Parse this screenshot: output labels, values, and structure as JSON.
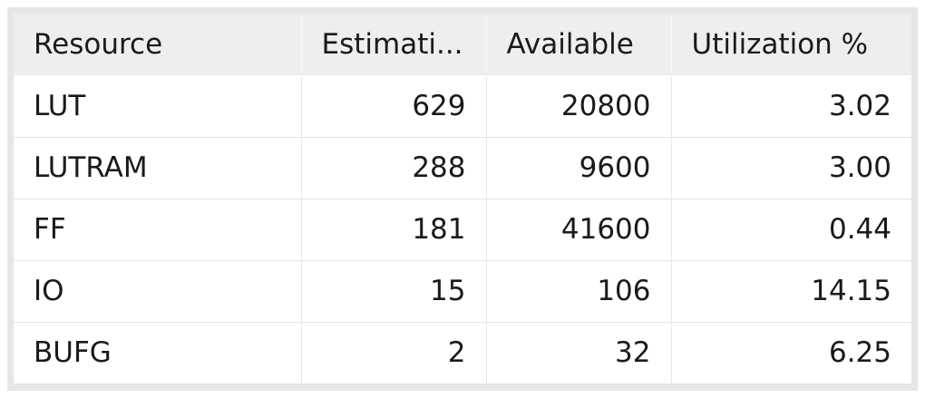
{
  "table": {
    "headers": [
      "Resource",
      "Estimati...",
      "Available",
      "Utilization %"
    ],
    "rows": [
      [
        "LUT",
        "629",
        "20800",
        "3.02"
      ],
      [
        "LUTRAM",
        "288",
        "9600",
        "3.00"
      ],
      [
        "FF",
        "181",
        "41600",
        "0.44"
      ],
      [
        "IO",
        "15",
        "106",
        "14.15"
      ],
      [
        "BUFG",
        "2",
        "32",
        "6.25"
      ]
    ]
  },
  "colors": {
    "frame": "#e6e6e6",
    "header_bg": "#eeeeee",
    "row_bg": "#ffffff",
    "text": "#1a1a1a"
  }
}
